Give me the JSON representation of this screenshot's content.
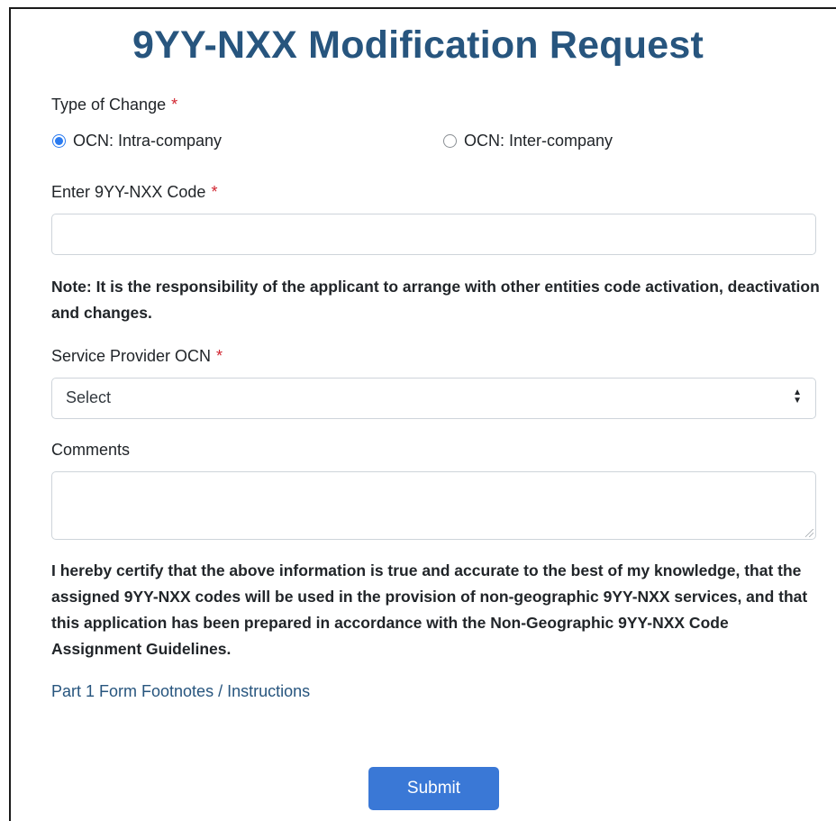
{
  "form": {
    "title": "9YY-NXX Modification Request",
    "required_marker": "*",
    "type_of_change": {
      "label": "Type of Change",
      "options": [
        {
          "label": "OCN: Intra-company",
          "checked": true
        },
        {
          "label": "OCN: Inter-company",
          "checked": false
        }
      ]
    },
    "code": {
      "label": "Enter 9YY-NXX Code",
      "value": ""
    },
    "note": "Note: It is the responsibility of the applicant to arrange with other entities code activation, deactivation and changes.",
    "service_provider": {
      "label": "Service Provider OCN",
      "selected": "Select"
    },
    "comments": {
      "label": "Comments",
      "value": ""
    },
    "certification": "I hereby certify that the above information is true and accurate to the best of my knowledge, that the assigned 9YY-NXX codes will be used in the provision of non-geographic 9YY-NXX services, and that this application has been prepared in accordance with the Non-Geographic 9YY-NXX Code Assignment Guidelines.",
    "footnotes_link": "Part 1 Form Footnotes / Instructions",
    "submit_label": "Submit"
  },
  "colors": {
    "title": "#27557e",
    "required": "#d1242f",
    "radio_accent": "#2b7bf0",
    "button": "#3a78d6",
    "link": "#27557e"
  }
}
